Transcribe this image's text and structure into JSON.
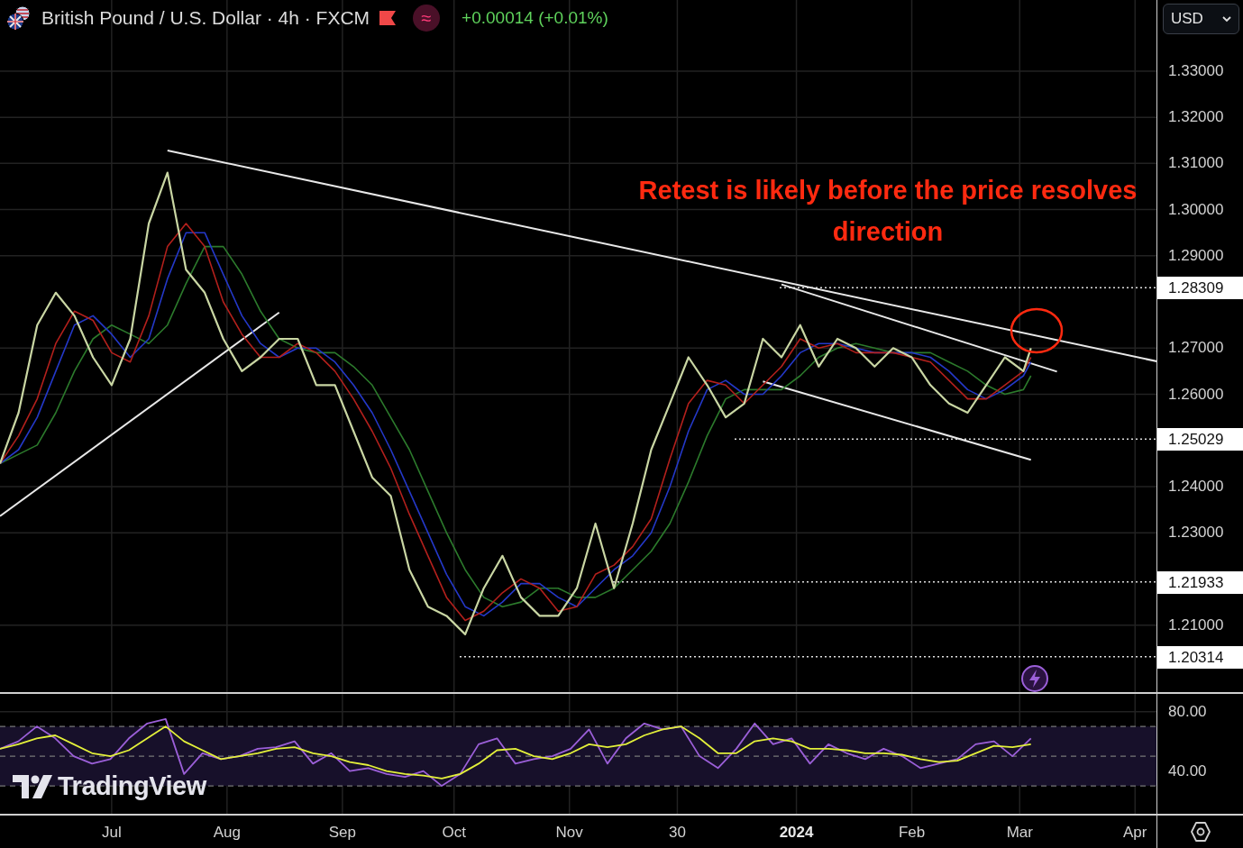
{
  "header": {
    "title": "British Pound / U.S. Dollar · 4h · FXCM",
    "indicator_symbol": "≈",
    "change": "+0.00014 (+0.01%)"
  },
  "currency_button": {
    "label": "USD"
  },
  "price_chart": {
    "chart_data": {
      "type": "line",
      "grid": true,
      "xlim": [
        "2023-06-01",
        "2024-04-30"
      ],
      "ylim": [
        1.1951,
        1.3454
      ],
      "x": [
        "2023-06-01",
        "2023-06-06",
        "2023-06-11",
        "2023-06-16",
        "2023-06-21",
        "2023-06-26",
        "2023-07-01",
        "2023-07-06",
        "2023-07-11",
        "2023-07-16",
        "2023-07-21",
        "2023-07-26",
        "2023-07-31",
        "2023-08-05",
        "2023-08-10",
        "2023-08-15",
        "2023-08-20",
        "2023-08-25",
        "2023-08-30",
        "2023-09-04",
        "2023-09-09",
        "2023-09-14",
        "2023-09-19",
        "2023-09-24",
        "2023-09-29",
        "2023-10-04",
        "2023-10-09",
        "2023-10-14",
        "2023-10-19",
        "2023-10-24",
        "2023-10-29",
        "2023-11-03",
        "2023-11-08",
        "2023-11-13",
        "2023-11-18",
        "2023-11-23",
        "2023-11-28",
        "2023-12-03",
        "2023-12-08",
        "2023-12-13",
        "2023-12-18",
        "2023-12-23",
        "2023-12-28",
        "2024-01-02",
        "2024-01-07",
        "2024-01-12",
        "2024-01-17",
        "2024-01-22",
        "2024-01-27",
        "2024-02-01",
        "2024-02-06",
        "2024-02-11",
        "2024-02-16",
        "2024-02-21",
        "2024-02-26",
        "2024-03-02",
        "2024-03-04",
        "2024-03-11",
        "2024-04-07"
      ],
      "series": [
        {
          "color": "#c9d6a3",
          "values": [
            1.245,
            1.256,
            1.275,
            1.282,
            1.277,
            1.268,
            1.262,
            1.272,
            1.297,
            1.308,
            1.287,
            1.282,
            1.272,
            1.265,
            1.268,
            1.272,
            1.272,
            1.262,
            1.262,
            1.252,
            1.242,
            1.238,
            1.222,
            1.214,
            1.212,
            1.208,
            1.218,
            1.225,
            1.216,
            1.212,
            1.212,
            1.218,
            1.232,
            1.218,
            1.232,
            1.248,
            1.258,
            1.268,
            1.262,
            1.255,
            1.258,
            1.272,
            1.268,
            1.275,
            1.266,
            1.272,
            1.27,
            1.266,
            1.27,
            1.268,
            1.262,
            1.258,
            1.256,
            1.262,
            1.268,
            1.265,
            1.27,
            null,
            null
          ]
        },
        {
          "color": "#b3201c",
          "values": [
            1.245,
            1.251,
            1.259,
            1.271,
            1.278,
            1.276,
            1.269,
            1.267,
            1.277,
            1.292,
            1.297,
            1.292,
            1.28,
            1.273,
            1.268,
            1.268,
            1.271,
            1.269,
            1.265,
            1.259,
            1.252,
            1.244,
            1.234,
            1.225,
            1.216,
            1.211,
            1.213,
            1.217,
            1.22,
            1.218,
            1.213,
            1.214,
            1.221,
            1.223,
            1.227,
            1.233,
            1.246,
            1.258,
            1.263,
            1.262,
            1.258,
            1.262,
            1.266,
            1.272,
            1.27,
            1.271,
            1.269,
            1.269,
            1.269,
            1.268,
            1.267,
            1.263,
            1.259,
            1.259,
            1.262,
            1.265,
            1.268,
            null,
            null
          ]
        },
        {
          "color": "#2438c8",
          "values": [
            1.245,
            1.248,
            1.255,
            1.265,
            1.275,
            1.277,
            1.273,
            1.268,
            1.272,
            1.285,
            1.295,
            1.295,
            1.286,
            1.277,
            1.271,
            1.268,
            1.27,
            1.27,
            1.267,
            1.262,
            1.256,
            1.248,
            1.239,
            1.23,
            1.221,
            1.214,
            1.212,
            1.215,
            1.219,
            1.219,
            1.216,
            1.214,
            1.218,
            1.222,
            1.225,
            1.23,
            1.24,
            1.252,
            1.261,
            1.263,
            1.26,
            1.26,
            1.264,
            1.269,
            1.271,
            1.271,
            1.27,
            1.269,
            1.269,
            1.269,
            1.268,
            1.265,
            1.261,
            1.259,
            1.261,
            1.264,
            1.267,
            null,
            null
          ]
        },
        {
          "color": "#2c7a2c",
          "values": [
            1.245,
            1.247,
            1.249,
            1.256,
            1.265,
            1.272,
            1.275,
            1.273,
            1.271,
            1.275,
            1.284,
            1.292,
            1.292,
            1.286,
            1.278,
            1.272,
            1.27,
            1.269,
            1.269,
            1.266,
            1.262,
            1.255,
            1.248,
            1.239,
            1.23,
            1.222,
            1.216,
            1.214,
            1.215,
            1.218,
            1.218,
            1.216,
            1.216,
            1.218,
            1.222,
            1.226,
            1.232,
            1.241,
            1.251,
            1.259,
            1.261,
            1.261,
            1.261,
            1.264,
            1.268,
            1.27,
            1.271,
            1.27,
            1.269,
            1.269,
            1.269,
            1.267,
            1.265,
            1.262,
            1.26,
            1.261,
            1.264,
            null,
            null
          ]
        },
        {
          "color": "#e8e8e8",
          "values": [
            null,
            null,
            null,
            null,
            null,
            null,
            null,
            null,
            null,
            1.3128,
            null,
            null,
            null,
            null,
            null,
            null,
            null,
            null,
            null,
            null,
            null,
            null,
            null,
            null,
            null,
            null,
            null,
            null,
            null,
            null,
            null,
            null,
            null,
            null,
            null,
            null,
            null,
            null,
            null,
            null,
            null,
            null,
            null,
            null,
            null,
            null,
            null,
            null,
            null,
            null,
            null,
            null,
            null,
            null,
            null,
            null,
            null,
            null,
            1.2671
          ]
        },
        {
          "color": "#e8e8e8",
          "values": [
            1.2336,
            null,
            null,
            null,
            null,
            null,
            null,
            null,
            null,
            null,
            null,
            null,
            null,
            null,
            null,
            1.2777,
            null,
            null,
            null,
            null,
            null,
            null,
            null,
            null,
            null,
            null,
            null,
            null,
            null,
            null,
            null,
            null,
            null,
            null,
            null,
            null,
            null,
            null,
            null,
            null,
            null,
            null,
            null,
            null,
            null,
            null,
            null,
            null,
            null,
            null,
            null,
            null,
            null,
            null,
            null,
            null,
            null,
            null,
            null
          ]
        },
        {
          "color": "#e8e8e8",
          "values": [
            null,
            null,
            null,
            null,
            null,
            null,
            null,
            null,
            null,
            null,
            null,
            null,
            null,
            null,
            null,
            null,
            null,
            null,
            null,
            null,
            null,
            null,
            null,
            null,
            null,
            null,
            null,
            null,
            null,
            null,
            null,
            null,
            null,
            null,
            null,
            null,
            null,
            null,
            null,
            null,
            null,
            null,
            1.2838,
            null,
            null,
            null,
            null,
            null,
            null,
            null,
            null,
            null,
            null,
            null,
            null,
            null,
            null,
            1.2649,
            null
          ]
        },
        {
          "color": "#e8e8e8",
          "values": [
            null,
            null,
            null,
            null,
            null,
            null,
            null,
            null,
            null,
            null,
            null,
            null,
            null,
            null,
            null,
            null,
            null,
            null,
            null,
            null,
            null,
            null,
            null,
            null,
            null,
            null,
            null,
            null,
            null,
            null,
            null,
            null,
            null,
            null,
            null,
            null,
            null,
            null,
            null,
            null,
            null,
            1.2628,
            null,
            null,
            null,
            null,
            null,
            null,
            null,
            null,
            null,
            null,
            null,
            null,
            null,
            null,
            1.2458,
            null,
            null
          ]
        }
      ],
      "xticks": [
        {
          "value": "2023-07-01",
          "label": "Jul"
        },
        {
          "value": "2023-08-01",
          "label": "Aug"
        },
        {
          "value": "2023-09-01",
          "label": "Sep"
        },
        {
          "value": "2023-10-01",
          "label": "Oct"
        },
        {
          "value": "2023-11-01",
          "label": "Nov"
        },
        {
          "value": "2023-11-30",
          "label": "30"
        },
        {
          "value": "2024-01-01",
          "label": "2024"
        },
        {
          "value": "2024-02-01",
          "label": "Feb"
        },
        {
          "value": "2024-03-01",
          "label": "Mar"
        },
        {
          "value": "2024-04-01",
          "label": "Apr"
        }
      ],
      "yticks": [
        {
          "value": 1.33,
          "label": "1.33000"
        },
        {
          "value": 1.32,
          "label": "1.32000"
        },
        {
          "value": 1.31,
          "label": "1.31000"
        },
        {
          "value": 1.3,
          "label": "1.30000"
        },
        {
          "value": 1.29,
          "label": "1.29000"
        },
        {
          "value": 1.27,
          "label": "1.27000"
        },
        {
          "value": 1.26,
          "label": "1.26000"
        },
        {
          "value": 1.24,
          "label": "1.24000"
        },
        {
          "value": 1.23,
          "label": "1.23000"
        },
        {
          "value": 1.21,
          "label": "1.21000"
        }
      ],
      "ref_lines": [
        {
          "axis": "y",
          "value": 1.28309,
          "label": "1.28309"
        },
        {
          "axis": "y",
          "value": 1.25029,
          "label": "1.25029"
        },
        {
          "axis": "y",
          "value": 1.21933,
          "label": "1.21933"
        },
        {
          "axis": "y",
          "value": 1.20314,
          "label": "1.20314"
        }
      ]
    },
    "annotation_text": "Retest is likely before the price resolves direction"
  },
  "rsi_pane": {
    "chart_data": {
      "type": "line",
      "grid": true,
      "ylim": [
        11.3,
        91.9
      ],
      "yticks": [
        {
          "value": 80,
          "label": "80.00"
        },
        {
          "value": 40,
          "label": "40.00"
        }
      ],
      "bands": [
        {
          "axis": "y",
          "from": 30,
          "to": 70
        }
      ],
      "categories": [
        null,
        null,
        null,
        null,
        null,
        null,
        null,
        null,
        null,
        null,
        null,
        null,
        null,
        null,
        null,
        null,
        null,
        null,
        null,
        null,
        null,
        null,
        null,
        null,
        null,
        null,
        null,
        null,
        null,
        null,
        null,
        null,
        null,
        null,
        null,
        null,
        null,
        null,
        null,
        null,
        null,
        null,
        null,
        null,
        null,
        null,
        null,
        null,
        null,
        null,
        null,
        null,
        null,
        null,
        null,
        null,
        null
      ],
      "series": [
        {
          "color": "#9b5fd8",
          "values": [
            55,
            60,
            70,
            62,
            50,
            45,
            48,
            62,
            72,
            75,
            38,
            52,
            48,
            50,
            55,
            56,
            60,
            45,
            52,
            40,
            42,
            38,
            36,
            40,
            30,
            38,
            58,
            62,
            45,
            48,
            50,
            55,
            68,
            45,
            62,
            72,
            68,
            70,
            50,
            42,
            55,
            72,
            58,
            62,
            45,
            58,
            52,
            48,
            55,
            50,
            42,
            45,
            48,
            58,
            60,
            50,
            62
          ]
        },
        {
          "color": "#e3f03a",
          "values": [
            55,
            58,
            62,
            64,
            58,
            52,
            50,
            54,
            62,
            70,
            60,
            54,
            48,
            50,
            52,
            55,
            56,
            52,
            50,
            46,
            44,
            40,
            38,
            37,
            35,
            38,
            45,
            54,
            55,
            50,
            48,
            52,
            58,
            56,
            58,
            64,
            68,
            70,
            62,
            52,
            52,
            60,
            62,
            60,
            55,
            55,
            54,
            52,
            52,
            51,
            48,
            46,
            47,
            52,
            57,
            56,
            58
          ]
        }
      ]
    }
  },
  "logo": {
    "text": "TradingView"
  }
}
